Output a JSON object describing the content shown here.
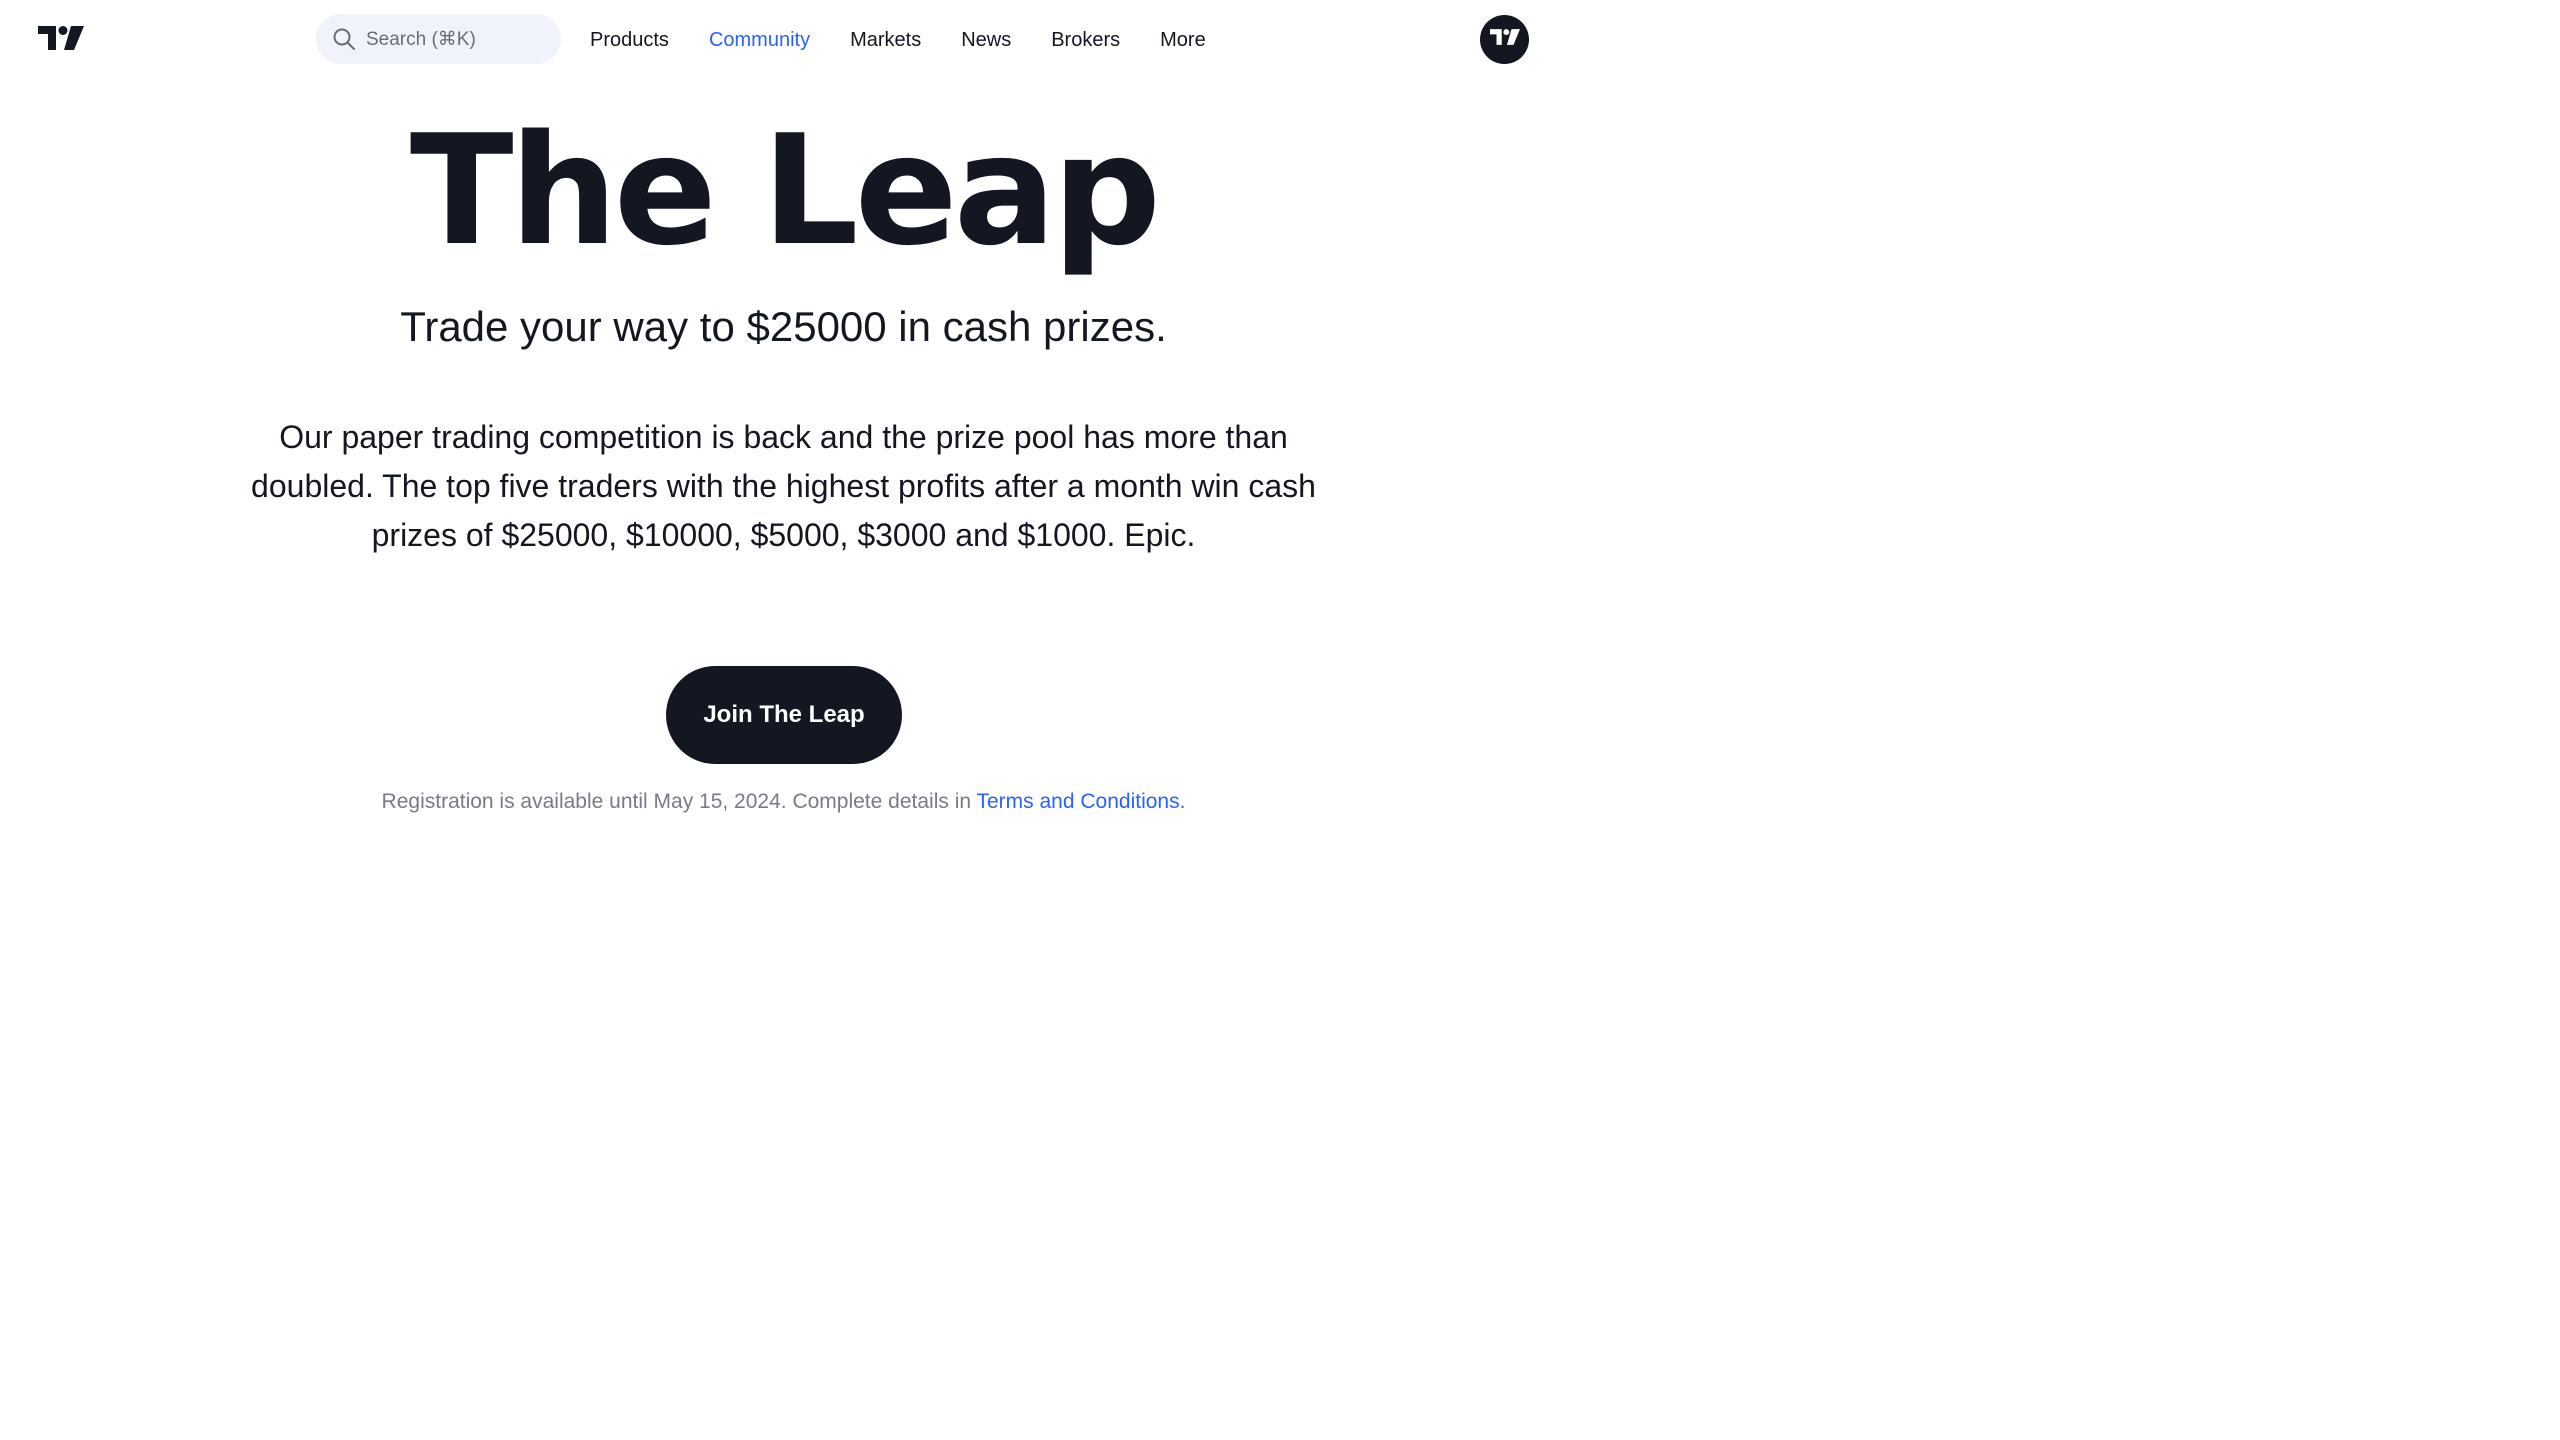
{
  "header": {
    "logo_icon": "tradingview-logo-icon",
    "search": {
      "icon": "search-icon",
      "placeholder": "Search (⌘K)"
    },
    "nav": [
      {
        "label": "Products",
        "active": false
      },
      {
        "label": "Community",
        "active": true
      },
      {
        "label": "Markets",
        "active": false
      },
      {
        "label": "News",
        "active": false
      },
      {
        "label": "Brokers",
        "active": false
      },
      {
        "label": "More",
        "active": false
      }
    ],
    "avatar_icon": "tradingview-logo-icon"
  },
  "hero": {
    "title": "The Leap",
    "subtitle": "Trade your way to $25000 in cash prizes.",
    "body": "Our paper trading competition is back and the prize pool has more than doubled. The top five traders with the highest profits after a month win cash prizes of $25000, $10000, $5000, $3000 and $1000. Epic.",
    "cta_label": "Join The Leap",
    "note_text": "Registration is available until May 15, 2024. Complete details in ",
    "note_link": "Terms and Conditions."
  },
  "colors": {
    "text": "#131722",
    "accent": "#2962ff",
    "muted": "#787b86",
    "search_bg": "#f0f3fa",
    "button_bg": "#131722"
  }
}
